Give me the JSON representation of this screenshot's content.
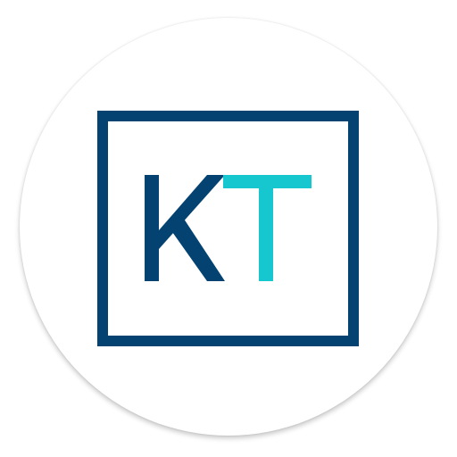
{
  "app_icon": {
    "letter_k": "K",
    "letter_t": "T",
    "colors": {
      "navy": "#034271",
      "teal": "#17C7D0",
      "background": "#ffffff"
    }
  }
}
